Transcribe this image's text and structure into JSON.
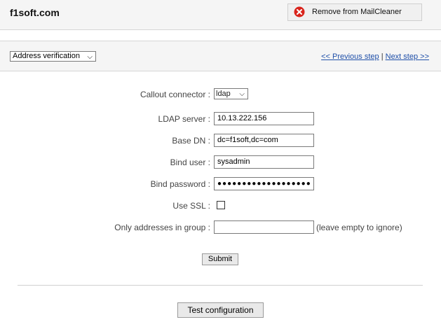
{
  "header": {
    "domain_title": "f1soft.com",
    "remove_button_label": "Remove from MailCleaner"
  },
  "toolbar": {
    "section_selected": "Address verification",
    "previous_step": "<< Previous step",
    "separator": "|",
    "next_step": "Next step >>"
  },
  "form": {
    "callout_connector": {
      "label": "Callout connector :",
      "value": "ldap"
    },
    "ldap_server": {
      "label": "LDAP server :",
      "value": "10.13.222.156"
    },
    "base_dn": {
      "label": "Base DN :",
      "value": "dc=f1soft,dc=com"
    },
    "bind_user": {
      "label": "Bind user :",
      "value": "sysadmin"
    },
    "bind_password": {
      "label": "Bind password :",
      "masked": "●●●●●●●●●●●●●●●●●●●"
    },
    "use_ssl": {
      "label": "Use SSL :",
      "checked": false
    },
    "only_group": {
      "label": "Only addresses in group :",
      "value": "",
      "hint": "(leave empty to ignore)"
    },
    "submit_label": "Submit"
  },
  "footer": {
    "test_button_label": "Test configuration"
  },
  "colors": {
    "link": "#1f4fa8",
    "remove_icon": "#d9241c"
  }
}
